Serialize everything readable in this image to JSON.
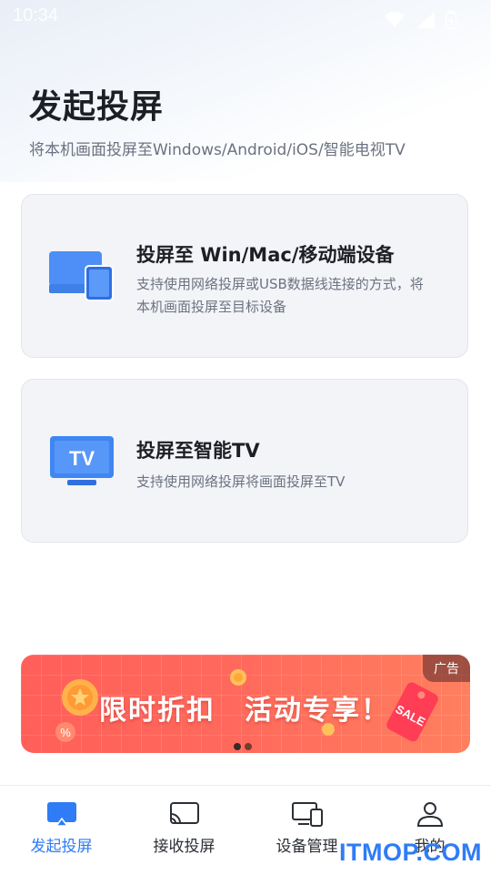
{
  "status_bar": {
    "time": "10:34"
  },
  "header": {
    "title": "发起投屏",
    "subtitle": "将本机画面投屏至Windows/Android/iOS/智能电视TV"
  },
  "cards": [
    {
      "title": "投屏至 Win/Mac/移动端设备",
      "description": "支持使用网络投屏或USB数据线连接的方式，将本机画面投屏至目标设备",
      "icon": "laptop-phone-icon"
    },
    {
      "title": "投屏至智能TV",
      "description": "支持使用网络投屏将画面投屏至TV",
      "icon": "tv-icon",
      "icon_text": "TV"
    }
  ],
  "ad": {
    "tag": "广告",
    "text": "限时折扣　活动专享！",
    "sale_tag": "SALE",
    "carousel": {
      "count": 2,
      "active_index": 1
    }
  },
  "tabs": [
    {
      "label": "发起投屏",
      "icon": "cast-screen-icon",
      "active": true
    },
    {
      "label": "接收投屏",
      "icon": "receive-cast-icon",
      "active": false
    },
    {
      "label": "设备管理",
      "icon": "devices-icon",
      "active": false
    },
    {
      "label": "我的",
      "icon": "person-icon",
      "active": false
    }
  ],
  "watermark": "ITMOP.COM",
  "colors": {
    "accent": "#2f7cf6",
    "card_bg": "#f3f4f8",
    "ad_red": "#ff5f59"
  }
}
